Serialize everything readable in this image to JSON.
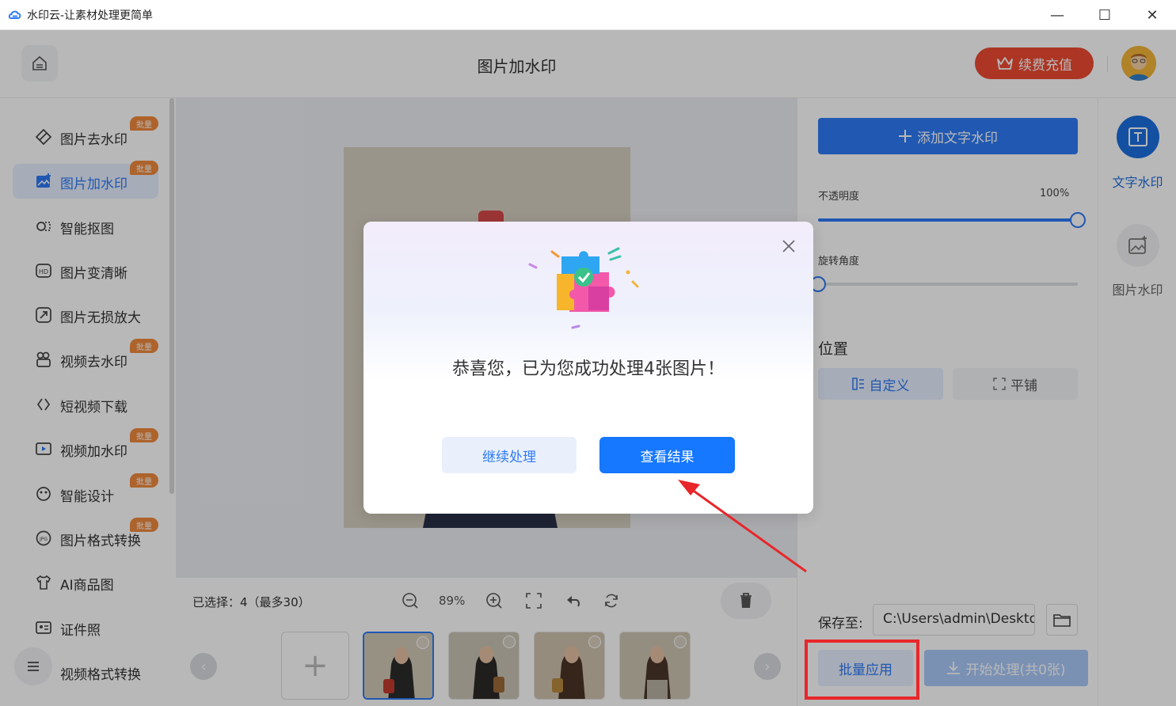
{
  "window": {
    "title": "水印云-让素材处理更简单",
    "minimize_glyph": "—",
    "maximize_glyph": "☐",
    "close_glyph": "✕"
  },
  "header": {
    "page_title": "图片加水印",
    "recharge_label": "续费充值"
  },
  "sidebar": {
    "items": [
      {
        "label": "图片去水印",
        "badge": "批量",
        "icon": "eraser-icon"
      },
      {
        "label": "图片加水印",
        "badge": "批量",
        "icon": "image-add-icon",
        "active": true
      },
      {
        "label": "智能抠图",
        "badge": "",
        "icon": "cutout-icon"
      },
      {
        "label": "图片变清晰",
        "badge": "",
        "icon": "hd-icon"
      },
      {
        "label": "图片无损放大",
        "badge": "",
        "icon": "enlarge-icon"
      },
      {
        "label": "视频去水印",
        "badge": "批量",
        "icon": "video-erase-icon"
      },
      {
        "label": "短视频下载",
        "badge": "",
        "icon": "link-icon"
      },
      {
        "label": "视频加水印",
        "badge": "批量",
        "icon": "video-add-icon"
      },
      {
        "label": "智能设计",
        "badge": "批量",
        "icon": "design-icon"
      },
      {
        "label": "图片格式转换",
        "badge": "批量",
        "icon": "jpg-icon"
      },
      {
        "label": "AI商品图",
        "badge": "",
        "icon": "shirt-icon"
      },
      {
        "label": "证件照",
        "badge": "",
        "icon": "id-photo-icon"
      },
      {
        "label": "视频格式转换",
        "badge": "",
        "icon": "video-convert-icon"
      }
    ]
  },
  "toolbar": {
    "selected_info": "已选择：4（最多30）",
    "zoom": "89%"
  },
  "right_panel": {
    "add_text_label": "添加文字水印",
    "opacity_label": "不透明度",
    "opacity_value": "100%",
    "opacity_fraction": 1.0,
    "rotation_label": "旋转角度",
    "rotation_fraction": 0.0,
    "position_title": "位置",
    "position_custom": "自定义",
    "position_tile": "平铺",
    "save_label": "保存至:",
    "save_path": "C:\\Users\\admin\\Desktop",
    "batch_apply": "批量应用",
    "start_process": "开始处理(共0张)"
  },
  "mode_rail": {
    "text_watermark": "文字水印",
    "image_watermark": "图片水印"
  },
  "dialog": {
    "message": "恭喜您，已为您成功处理4张图片！",
    "continue_label": "继续处理",
    "view_label": "查看结果"
  },
  "colors": {
    "accent": "#2f7bf5",
    "recharge": "#ef4a32",
    "badge": "#f08a3c",
    "annotation_red": "#e8262a"
  }
}
